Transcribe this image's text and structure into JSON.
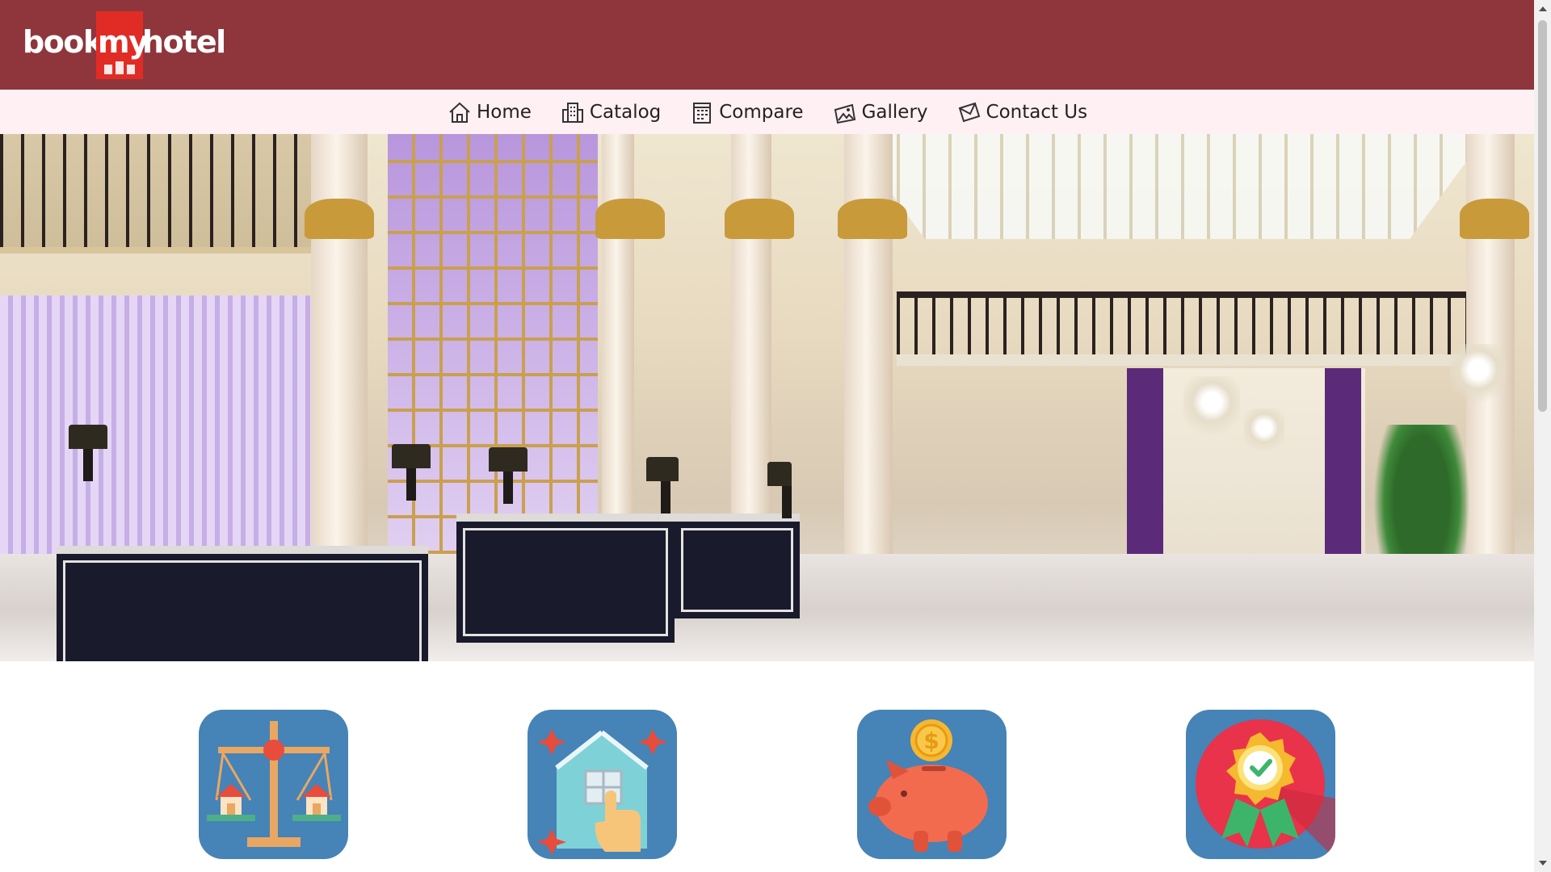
{
  "header": {
    "logo": {
      "word1": "book",
      "word2": "my",
      "word3": "hotel",
      "brand_color": "#8e363c",
      "badge_color": "#e12c25"
    }
  },
  "nav": {
    "items": [
      {
        "label": "Home",
        "icon": "home-icon"
      },
      {
        "label": "Catalog",
        "icon": "building-icon"
      },
      {
        "label": "Compare",
        "icon": "calendar-icon"
      },
      {
        "label": "Gallery",
        "icon": "gallery-icon"
      },
      {
        "label": "Contact Us",
        "icon": "mail-icon"
      }
    ]
  },
  "hero": {
    "description_icon": "hotel-lobby-photo"
  },
  "features": [
    {
      "icon": "scale-compare-icon"
    },
    {
      "icon": "house-touch-icon"
    },
    {
      "icon": "piggy-bank-icon"
    },
    {
      "icon": "award-badge-icon"
    }
  ],
  "colors": {
    "nav_bg": "#fff0f4",
    "feature_bg": "#4683b6"
  }
}
